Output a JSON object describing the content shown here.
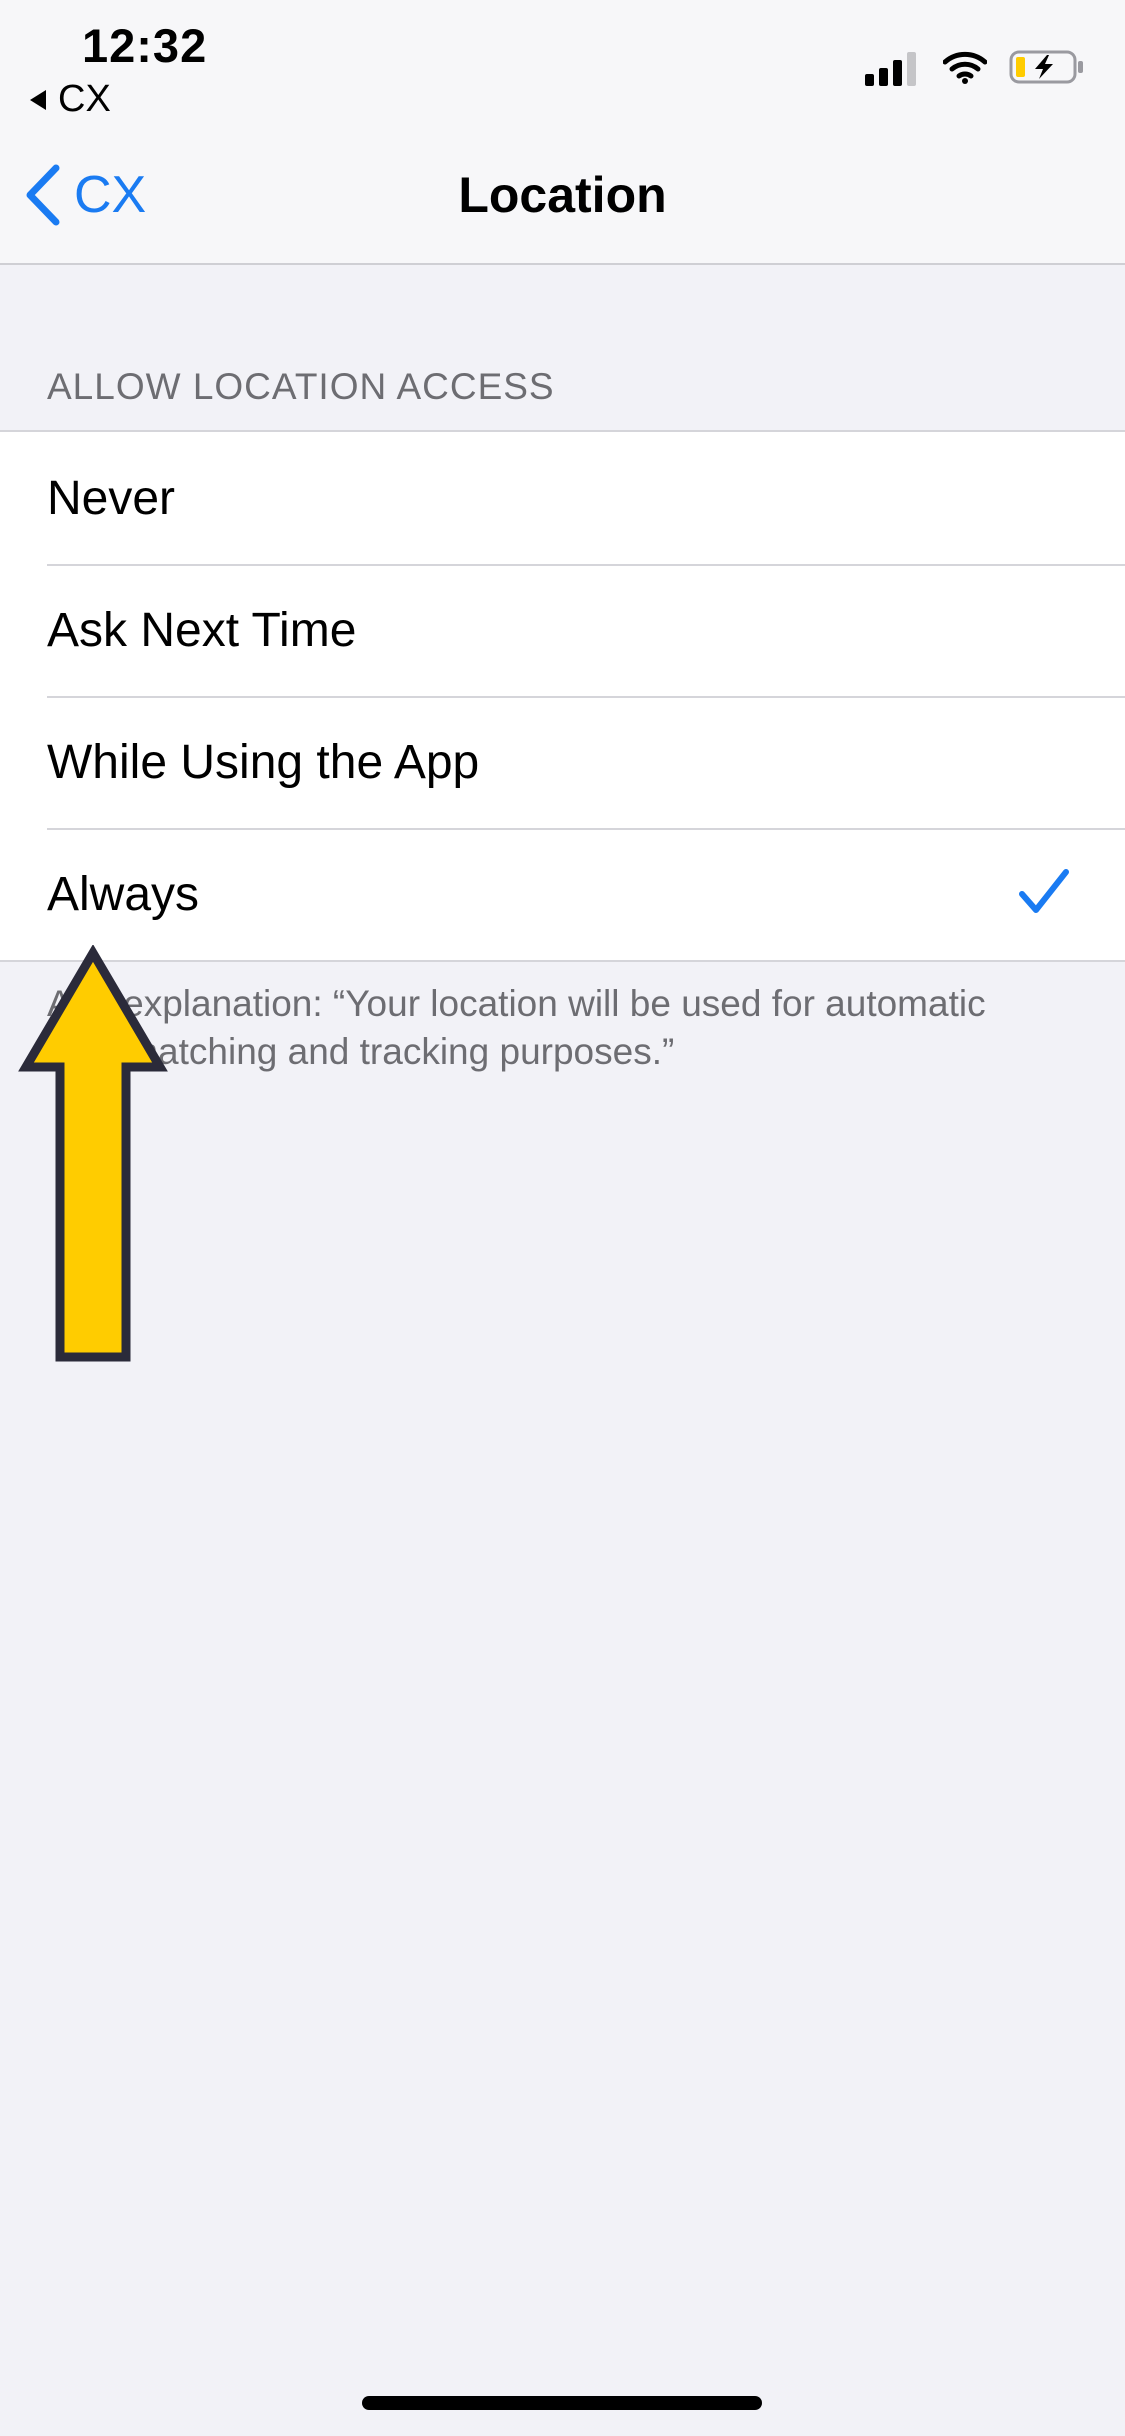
{
  "status_bar": {
    "time": "12:32",
    "back_app": "CX",
    "signal_icon": "cellular-signal-icon",
    "wifi_icon": "wifi-icon",
    "battery_icon": "battery-charging-icon"
  },
  "nav": {
    "back_label": "CX",
    "title": "Location",
    "accent": "#1a7bf2"
  },
  "section": {
    "header": "ALLOW LOCATION ACCESS",
    "options": [
      {
        "label": "Never",
        "selected": false
      },
      {
        "label": "Ask Next Time",
        "selected": false
      },
      {
        "label": "While Using the App",
        "selected": false
      },
      {
        "label": "Always",
        "selected": true
      }
    ],
    "footer": "App explanation: “Your location will be used for automatic load matching and tracking purposes.”"
  },
  "annotation": {
    "arrow_color": "#ffcc00",
    "arrow_outline": "#2b2b3a"
  }
}
